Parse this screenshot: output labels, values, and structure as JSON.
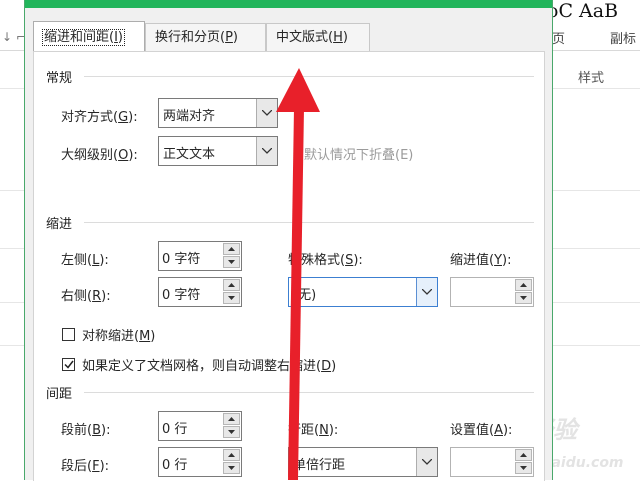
{
  "background": {
    "style_sample_1": "oC AaB",
    "style_sample_2": "副标",
    "style_sample_0": "页",
    "styles_group_label": "样式",
    "watermark": "Bai 经验",
    "watermark_sub": "jingyan.baidu.com"
  },
  "dialog": {
    "tabs": [
      {
        "label": "缩进和间距(",
        "key": "I",
        "suffix": ")"
      },
      {
        "label": "换行和分页(",
        "key": "P",
        "suffix": ")"
      },
      {
        "label": "中文版式(",
        "key": "H",
        "suffix": ")"
      }
    ],
    "general": {
      "section_label": "常规",
      "alignment_label": "对齐方式(",
      "alignment_key": "G",
      "alignment_value": "两端对齐",
      "outline_label": "大纲级别(",
      "outline_key": "O",
      "outline_value": "正文文本",
      "collapse_label": "默认情况下折叠(E)"
    },
    "indent": {
      "section_label": "缩进",
      "left_label": "左侧(",
      "left_key": "L",
      "left_value": "0 字符",
      "right_label": "右侧(",
      "right_key": "R",
      "right_value": "0 字符",
      "special_label": "特殊格式(",
      "special_key": "S",
      "special_value": "(无)",
      "by_label": "缩进值(",
      "by_key": "Y",
      "by_value": "",
      "mirror_label": "对称缩进(",
      "mirror_key": "M",
      "mirror_checked": false,
      "grid_label": "如果定义了文档网格，则自动调整右缩进(",
      "grid_key": "D",
      "grid_checked": true
    },
    "spacing": {
      "section_label": "间距",
      "before_label": "段前(",
      "before_key": "B",
      "before_value": "0 行",
      "after_label": "段后(",
      "after_key": "F",
      "after_value": "0 行",
      "line_label": "行距(",
      "line_key": "N",
      "line_value": "单倍行距",
      "at_label": "设置值(",
      "at_key": "A",
      "at_value": ""
    }
  },
  "colors": {
    "title_bar": "#21b55b",
    "annotation_arrow": "#e8202a"
  }
}
